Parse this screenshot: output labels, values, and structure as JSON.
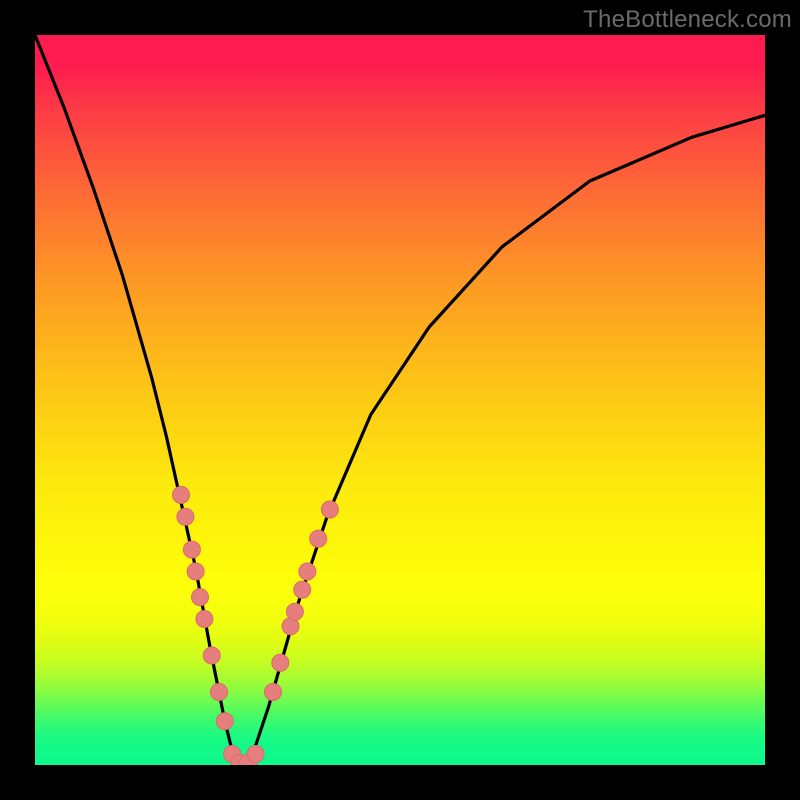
{
  "watermark": "TheBottleneck.com",
  "colors": {
    "background": "#000000",
    "curve": "#000000",
    "marker_fill": "#e77e7e",
    "marker_stroke": "#d96a6a"
  },
  "chart_data": {
    "type": "line",
    "title": "",
    "xlabel": "",
    "ylabel": "",
    "xlim": [
      0,
      100
    ],
    "ylim": [
      0,
      100
    ],
    "grid": false,
    "series": [
      {
        "name": "bottleneck-curve",
        "x": [
          0,
          4,
          8,
          12,
          16,
          18,
          20,
          22,
          24,
          26,
          27,
          28,
          29,
          30,
          32,
          34,
          36,
          40,
          46,
          54,
          64,
          76,
          90,
          100
        ],
        "y": [
          100,
          90,
          79,
          67,
          53,
          45,
          36,
          27,
          16,
          6,
          2,
          0,
          0,
          2,
          8,
          15,
          22,
          34,
          48,
          60,
          71,
          80,
          86,
          89
        ]
      }
    ],
    "markers": {
      "name": "data-points",
      "points": [
        {
          "x": 20.0,
          "y": 37.0
        },
        {
          "x": 20.6,
          "y": 34.0
        },
        {
          "x": 21.5,
          "y": 29.5
        },
        {
          "x": 22.0,
          "y": 26.5
        },
        {
          "x": 22.6,
          "y": 23.0
        },
        {
          "x": 23.2,
          "y": 20.0
        },
        {
          "x": 24.2,
          "y": 15.0
        },
        {
          "x": 25.2,
          "y": 10.0
        },
        {
          "x": 26.0,
          "y": 6.0
        },
        {
          "x": 27.0,
          "y": 1.5
        },
        {
          "x": 28.0,
          "y": 0.3
        },
        {
          "x": 29.2,
          "y": 0.3
        },
        {
          "x": 30.2,
          "y": 1.5
        },
        {
          "x": 32.6,
          "y": 10.0
        },
        {
          "x": 33.6,
          "y": 14.0
        },
        {
          "x": 35.0,
          "y": 19.0
        },
        {
          "x": 35.6,
          "y": 21.0
        },
        {
          "x": 36.6,
          "y": 24.0
        },
        {
          "x": 37.3,
          "y": 26.5
        },
        {
          "x": 38.8,
          "y": 31.0
        },
        {
          "x": 40.4,
          "y": 35.0
        }
      ]
    }
  }
}
